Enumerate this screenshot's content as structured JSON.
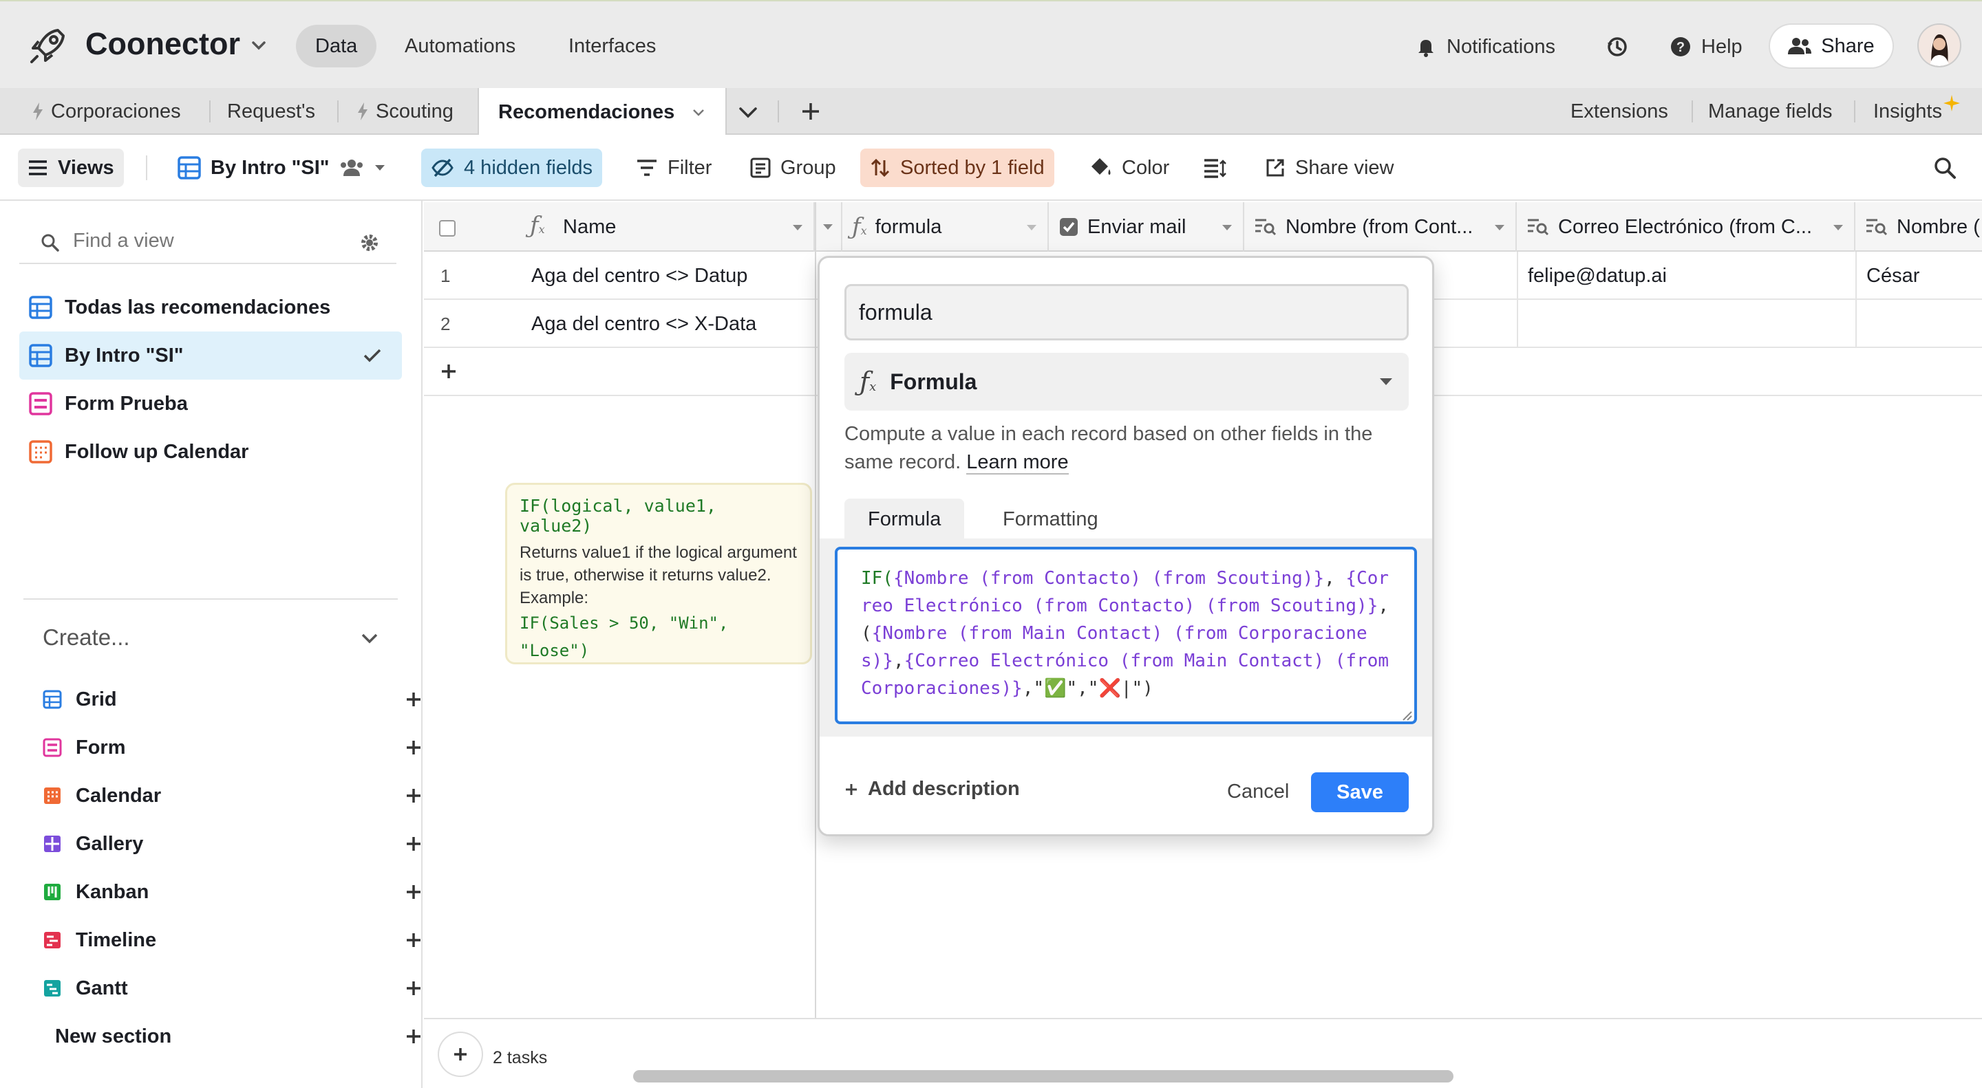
{
  "header": {
    "app_title": "Coonector",
    "nav": [
      "Data",
      "Automations",
      "Interfaces"
    ],
    "notifications": "Notifications",
    "help": "Help",
    "share": "Share"
  },
  "tabs": {
    "items": [
      "Corporaciones",
      "Request's",
      "Scouting",
      "Recomendaciones"
    ],
    "extensions": "Extensions",
    "manage_fields": "Manage fields",
    "insights": "Insights"
  },
  "toolbar": {
    "views": "Views",
    "current_view": "By Intro \"SI\"",
    "hidden_fields": "4 hidden fields",
    "filter": "Filter",
    "group": "Group",
    "sorted": "Sorted by 1 field",
    "color": "Color",
    "share_view": "Share view"
  },
  "sidebar": {
    "find_placeholder": "Find a view",
    "views": [
      "Todas las recomendaciones",
      "By Intro \"SI\"",
      "Form Prueba",
      "Follow up Calendar"
    ],
    "create_title": "Create...",
    "create_items": [
      "Grid",
      "Form",
      "Calendar",
      "Gallery",
      "Kanban",
      "Timeline",
      "Gantt"
    ],
    "new_section": "New section"
  },
  "grid": {
    "columns": [
      "Name",
      "formula",
      "Enviar mail",
      "Nombre (from Cont...",
      "Correo Electrónico (from C...",
      "Nombre ("
    ],
    "rows": [
      {
        "num": "1",
        "name": "Aga del centro <> Datup",
        "correo": "felipe@datup.ai",
        "nombre2": "César"
      },
      {
        "num": "2",
        "name": "Aga del centro <> X-Data",
        "correo": "",
        "nombre2": ""
      }
    ],
    "tasks": "2 tasks"
  },
  "tooltip": {
    "signature": "IF(logical, value1, value2)",
    "description": "Returns value1 if the logical argument is true, otherwise it returns value2. Example:",
    "example": "IF(Sales > 50, \"Win\", \"Lose\")"
  },
  "editor": {
    "field_name": "formula",
    "field_type": "Formula",
    "description": "Compute a value in each record based on other fields in the same record.",
    "learn_more": "Learn more",
    "tab_formula": "Formula",
    "tab_formatting": "Formatting",
    "code": {
      "fn": "IF(",
      "a": "{Nombre (from Contacto) (from Scouting)}",
      "b": "{Correo Electrónico (from Contacto) (from Scouting)}",
      "c": "{Nombre (from Main Contact) (from Corporaciones)}",
      "d": "{Correo Electrónico (from Main Contact) (from Corporaciones)}",
      "check": "✅",
      "cross": "❌"
    },
    "add_description": "Add description",
    "cancel": "Cancel",
    "save": "Save"
  },
  "colors": {
    "accent_blue": "#2d7ff9",
    "hidden_fields_bg": "#c9e7f8",
    "sorted_bg": "#fbdccd",
    "formula_field_color": "#7b3fd6",
    "formula_fn_color": "#1f7a26"
  }
}
